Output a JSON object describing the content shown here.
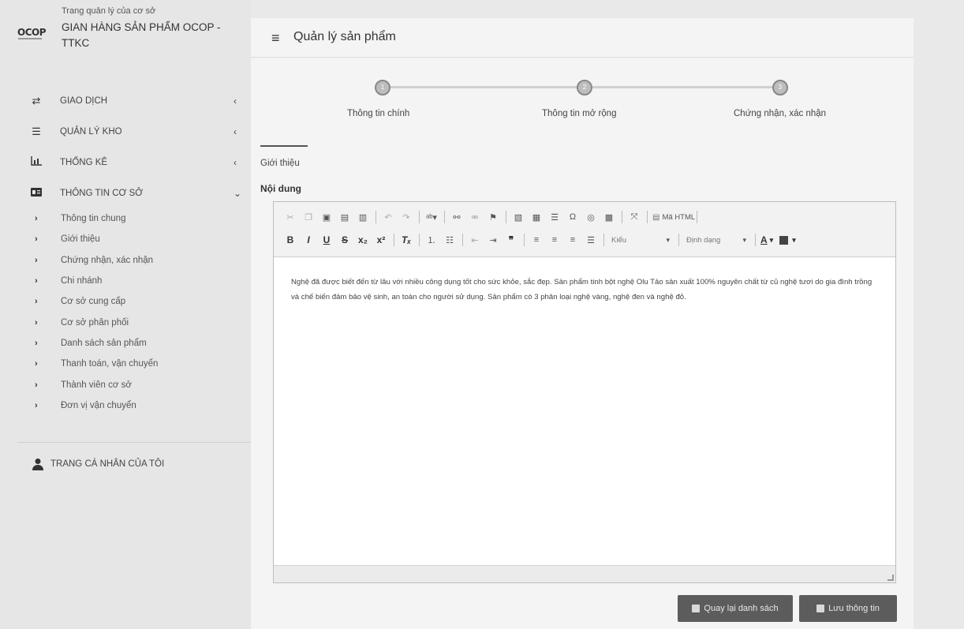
{
  "brand": {
    "logo": "OCOP",
    "subtitle": "Trang quản lý của cơ sở",
    "name": "GIAN HÀNG SẢN PHẨM OCOP - TTKC"
  },
  "sidebar": {
    "items": [
      {
        "label": "GIAO DỊCH",
        "icon": "exchange-icon",
        "chevron": "‹"
      },
      {
        "label": "QUẢN LÝ KHO",
        "icon": "list-icon",
        "chevron": "‹"
      },
      {
        "label": "THỐNG KÊ",
        "icon": "bar-chart-icon",
        "chevron": "‹"
      },
      {
        "label": "THÔNG TIN CƠ SỞ",
        "icon": "id-card-icon",
        "chevron": "⌄"
      }
    ],
    "sub_items": [
      "Thông tin chung",
      "Giới thiệu",
      "Chứng nhận, xác nhận",
      "Chi nhánh",
      "Cơ sở cung cấp",
      "Cơ sở phân phối",
      "Danh sách sản phẩm",
      "Thanh toán, vận chuyển",
      "Thành viên cơ sở",
      "Đơn vị vận chuyển"
    ],
    "profile_label": "TRANG CÁ NHÂN CỦA TÔI"
  },
  "header": {
    "title": "Quản lý sản phẩm"
  },
  "steps": [
    {
      "number": "1",
      "label": "Thông tin chính"
    },
    {
      "number": "2",
      "label": "Thông tin mở rộng"
    },
    {
      "number": "3",
      "label": "Chứng nhận, xác nhận"
    }
  ],
  "tab": {
    "active_label": "Giới thiệu"
  },
  "field": {
    "label": "Nội dung"
  },
  "editor": {
    "source_label": "Mã HTML",
    "style_combo": "Kiểu",
    "format_combo": "Định dạng",
    "content": "Nghệ đã được biết đến từ lâu với nhiều công dụng tốt cho sức khỏe, sắc đẹp. Sản phẩm tinh bột nghệ Olu Tảo sản xuất 100% nguyên chất từ củ nghệ tươi do gia đình trồng và chế biến đảm bảo vệ sinh, an toàn cho người sử dụng. Sản phẩm có 3 phân loại nghệ vàng, nghệ đen và nghệ đỏ."
  },
  "buttons": {
    "back": "Quay lại danh sách",
    "save": "Lưu thông tin"
  }
}
